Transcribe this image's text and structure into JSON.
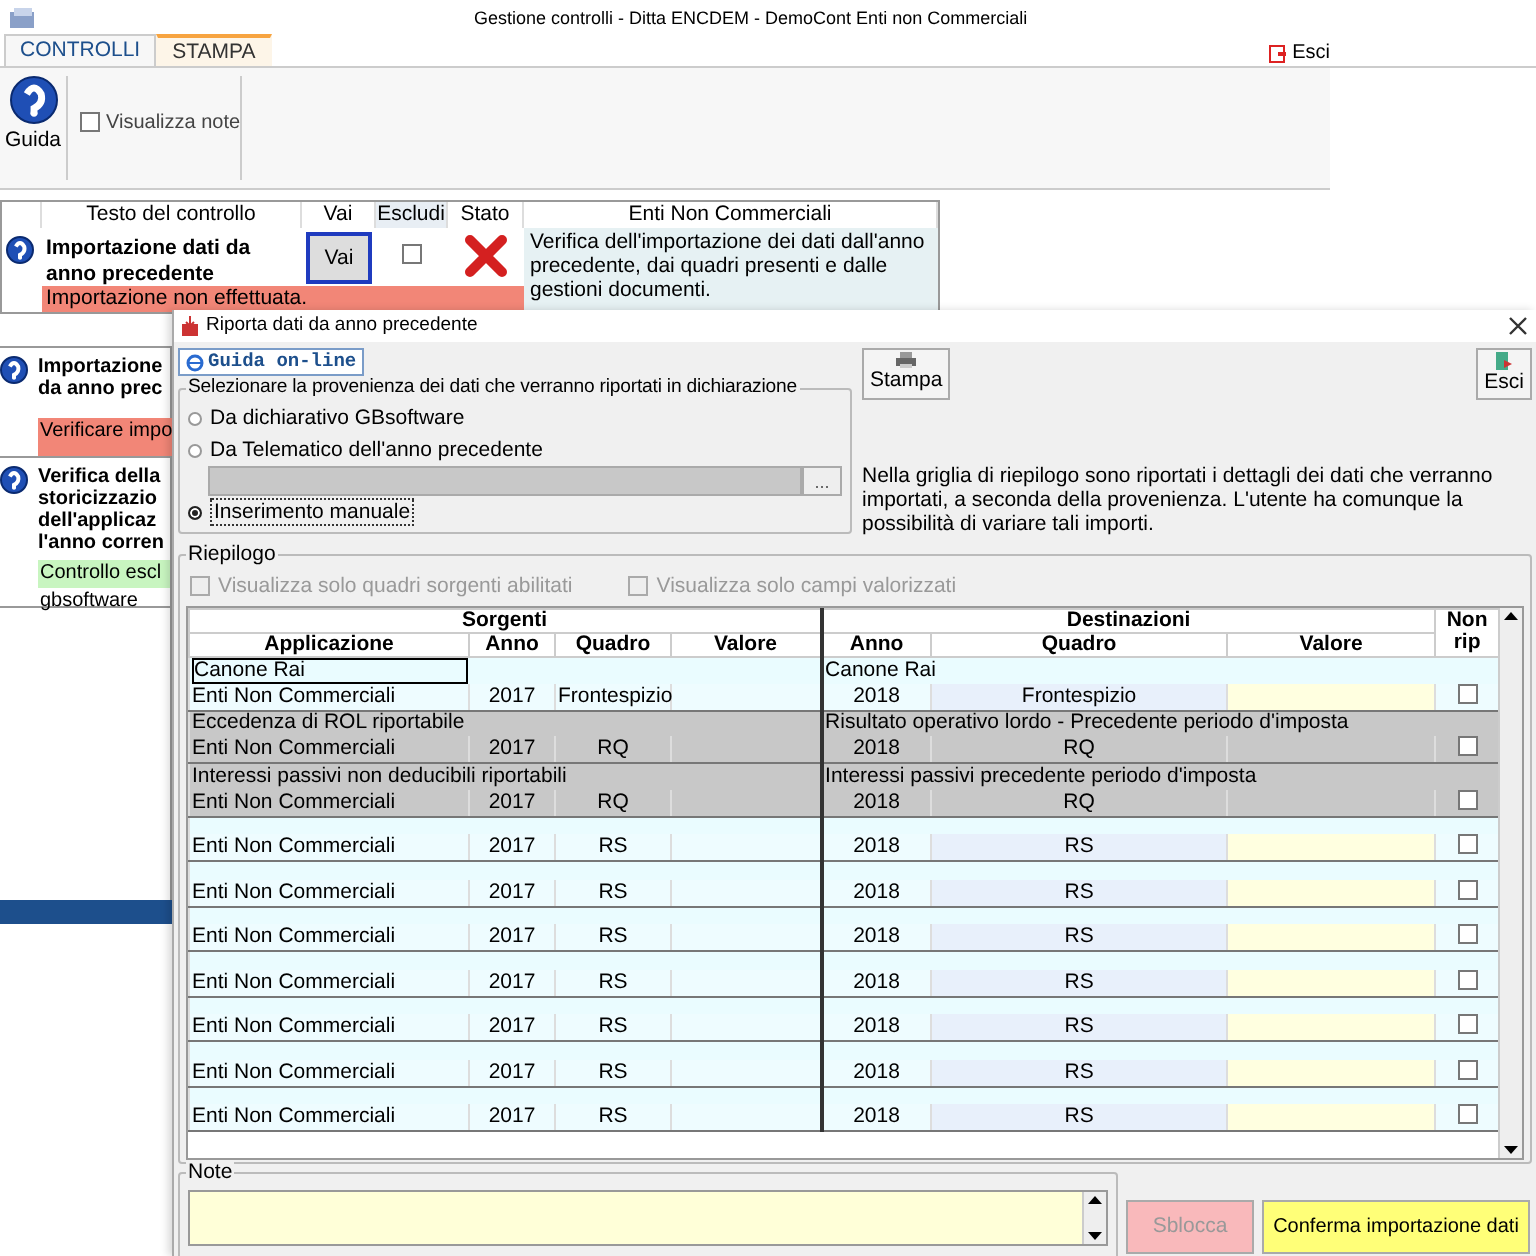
{
  "window": {
    "title": "Gestione controlli - Ditta ENCDEM - DemoCont Enti non Commerciali"
  },
  "tabs": [
    {
      "label": "CONTROLLI",
      "selected": true
    },
    {
      "label": "STAMPA",
      "selected": false
    }
  ],
  "exit_label": "Esci",
  "ribbon": {
    "help_label": "Guida",
    "show_notes": {
      "label": "Visualizza note",
      "checked": false
    }
  },
  "controls_grid": {
    "columns": [
      "Testo del controllo",
      "Vai",
      "Escludi",
      "Stato",
      "Enti Non Commerciali"
    ],
    "rows": [
      {
        "text": "Importazione dati da anno precedente",
        "button": "Vai",
        "excluded": false,
        "passed": false,
        "description": "Verifica dell'importazione dei dati dall'anno precedente, dai quadri presenti e dalle gestioni documenti.",
        "message": {
          "text": "Importazione non effettuata.",
          "kind": "error"
        }
      }
    ],
    "partial_rows": [
      {
        "text_lines": [
          "Importazione",
          "da anno prec"
        ],
        "message": {
          "text": "Verificare impo",
          "kind": "error"
        }
      },
      {
        "text_lines": [
          "Verifica della",
          "storicizzazio",
          "dell'applicaz",
          "l'anno corren"
        ],
        "message": {
          "text": "Controllo escl",
          "kind": "excluded"
        },
        "note": "gbsoftware"
      }
    ]
  },
  "dialog": {
    "title": "Riporta dati da anno precedente",
    "help_button": "Guida on-line",
    "print_button": "Stampa",
    "exit_button": "Esci",
    "source_group": {
      "title": "Selezionare la provenienza dei dati che verranno riportati in dichiarazione",
      "options": [
        {
          "label": "Da dichiarativo GBsoftware",
          "selected": false
        },
        {
          "label": "Da Telematico dell'anno precedente",
          "selected": false
        },
        {
          "label": "Inserimento manuale",
          "selected": true
        }
      ],
      "browse_button": "..."
    },
    "info": "Nella griglia di riepilogo sono riportati i dettagli dei dati che verranno importati, a seconda della provenienza. L'utente ha comunque la possibilità di variare tali importi.",
    "summary": {
      "title": "Riepilogo",
      "filters": [
        {
          "label": "Visualizza solo quadri sorgenti abilitati",
          "checked": false,
          "disabled": true
        },
        {
          "label": "Visualizza solo campi valorizzati",
          "checked": false,
          "disabled": true
        }
      ],
      "sections": [
        "Sorgenti",
        "Destinazioni"
      ],
      "columns": [
        "Applicazione",
        "Anno",
        "Quadro",
        "Valore",
        "Anno",
        "Quadro",
        "Valore",
        "Non rip"
      ],
      "groups": [
        {
          "source": "Canone Rai",
          "destination": "Canone Rai",
          "application": "Enti Non Commerciali",
          "source_year": "2017",
          "source_frame": "Frontespizio",
          "dest_year": "2018",
          "dest_frame": "Frontespizio",
          "disabled": false,
          "not_carried": false
        },
        {
          "source": "Eccedenza di ROL riportabile",
          "destination": "Risultato operativo lordo - Precedente periodo d'imposta",
          "application": "Enti Non Commerciali",
          "source_year": "2017",
          "source_frame": "RQ",
          "dest_year": "2018",
          "dest_frame": "RQ",
          "disabled": true,
          "not_carried": false
        },
        {
          "source": "Interessi passivi non deducibili riportabili",
          "destination": "Interessi passivi precedente periodo d'imposta",
          "application": "Enti Non Commerciali",
          "source_year": "2017",
          "source_frame": "RQ",
          "dest_year": "2018",
          "dest_frame": "RQ",
          "disabled": true,
          "not_carried": false
        },
        {
          "application": "Enti Non Commerciali",
          "source_year": "2017",
          "source_frame": "RS",
          "dest_year": "2018",
          "dest_frame": "RS",
          "disabled": false,
          "not_carried": false
        },
        {
          "application": "Enti Non Commerciali",
          "source_year": "2017",
          "source_frame": "RS",
          "dest_year": "2018",
          "dest_frame": "RS",
          "disabled": false,
          "not_carried": false
        },
        {
          "application": "Enti Non Commerciali",
          "source_year": "2017",
          "source_frame": "RS",
          "dest_year": "2018",
          "dest_frame": "RS",
          "disabled": false,
          "not_carried": false
        },
        {
          "application": "Enti Non Commerciali",
          "source_year": "2017",
          "source_frame": "RS",
          "dest_year": "2018",
          "dest_frame": "RS",
          "disabled": false,
          "not_carried": false
        },
        {
          "application": "Enti Non Commerciali",
          "source_year": "2017",
          "source_frame": "RS",
          "dest_year": "2018",
          "dest_frame": "RS",
          "disabled": false,
          "not_carried": false
        },
        {
          "application": "Enti Non Commerciali",
          "source_year": "2017",
          "source_frame": "RS",
          "dest_year": "2018",
          "dest_frame": "RS",
          "disabled": false,
          "not_carried": false
        },
        {
          "application": "Enti Non Commerciali",
          "source_year": "2017",
          "source_frame": "RS",
          "dest_year": "2018",
          "dest_frame": "RS",
          "disabled": false,
          "not_carried": false
        }
      ]
    },
    "notes": {
      "label": "Note"
    },
    "buttons": [
      {
        "label": "Sblocca",
        "kind": "unlock",
        "disabled": true
      },
      {
        "label": "Conferma importazione dati",
        "kind": "confirm",
        "disabled": false
      }
    ]
  }
}
